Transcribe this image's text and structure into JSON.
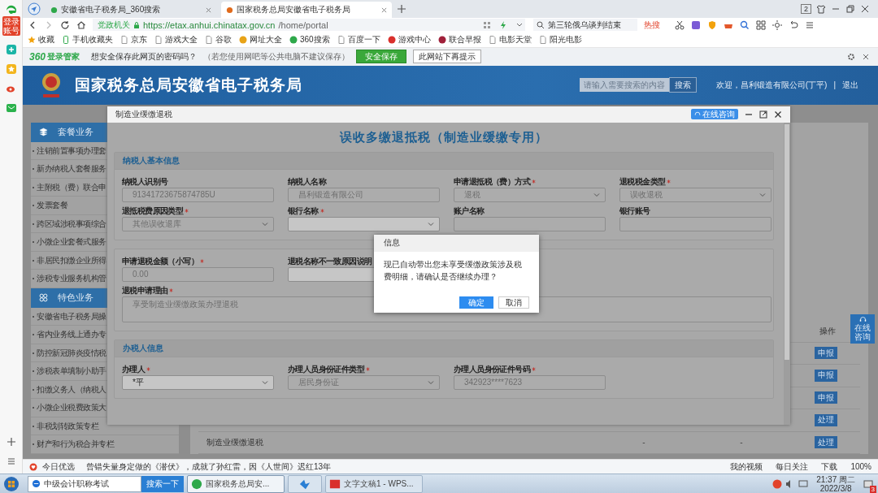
{
  "sidebar_strip": {
    "login_label": "登录账号"
  },
  "tabs": [
    {
      "title": "安徽省电子税务局_360搜索",
      "selected": false
    },
    {
      "title": "国家税务总局安徽省电子税务局",
      "selected": true
    }
  ],
  "window_badge": "2",
  "address_bar": {
    "badge": "党政机关",
    "url_host": "https://etax.anhui.chinatax.gov.cn",
    "url_path": "/home/portal"
  },
  "search_bar": {
    "value": "第三轮俄乌谈判结束",
    "hot": "热搜"
  },
  "bookmarks": [
    {
      "label": "收藏",
      "kind": "star"
    },
    {
      "label": "手机收藏夹",
      "kind": "phone"
    },
    {
      "label": "京东",
      "kind": "page"
    },
    {
      "label": "游戏大全",
      "kind": "page"
    },
    {
      "label": "谷歌",
      "kind": "page"
    },
    {
      "label": "网址大全",
      "kind": "logo",
      "color": "#e8a317"
    },
    {
      "label": "360搜索",
      "kind": "logo",
      "color": "#2ea84a"
    },
    {
      "label": "百度一下",
      "kind": "page"
    },
    {
      "label": "游戏中心",
      "kind": "logo",
      "color": "#d9302c"
    },
    {
      "label": "联合早报",
      "kind": "logo",
      "color": "#a0203a"
    },
    {
      "label": "电影天堂",
      "kind": "page"
    },
    {
      "label": "阳光电影",
      "kind": "page"
    }
  ],
  "password_bar": {
    "brand": "360",
    "brand_sub": "登录管家",
    "question": "想安全保存此网页的密码吗？",
    "hint": "（若您使用网吧等公共电脑不建议保存）",
    "save": "安全保存",
    "never": "此网站下再提示"
  },
  "site_header": {
    "title": "国家税务总局安徽省电子税务局",
    "search_placeholder": "请输入需要搜索的内容",
    "search_button": "搜索",
    "welcome": "欢迎，昌利锻造有限公司(丁平)",
    "separator": "|",
    "logout": "退出"
  },
  "menu": [
    {
      "title": "套餐业务",
      "kind": "package",
      "items": [
        "注销前置事项办理套",
        "新办纳税人套餐服务",
        "主附税（费）联合申",
        "发票套餐",
        "跨区域涉税事项综合",
        "小微企业套餐式服务",
        "非居民扣缴企业所得",
        "涉税专业服务机构管"
      ]
    },
    {
      "title": "特色业务",
      "kind": "feature",
      "items": [
        "安徽省电子税务局操",
        "省内业务线上通办专",
        "防控新冠肺炎疫情税",
        "涉税表单填制小助手",
        "扣缴义务人（纳税人",
        "小微企业税费政策大",
        "非税划转政策专栏",
        "财产和行为税合并专栏"
      ]
    }
  ],
  "table": {
    "action_header": "操作",
    "rows": [
      {
        "action": "申报"
      },
      {
        "action": "申报"
      },
      {
        "action": "申报"
      },
      {
        "action": "处理"
      },
      {
        "name": "制造业缓缴退税",
        "column_2": "-",
        "column_3": "-",
        "action": "处理"
      }
    ]
  },
  "float_button": "在线咨询",
  "modal": {
    "title": "制造业缓缴退税",
    "consult": "在线咨询",
    "heading": "误收多缴退抵税（制造业缓缴专用）",
    "sections": [
      {
        "title": "纳税人基本信息",
        "fields": [
          {
            "label": "纳税人识别号",
            "kind": "input",
            "value": "91341723675874785U",
            "required": false,
            "disabled": true
          },
          {
            "label": "纳税人名称",
            "kind": "input",
            "value": "昌利锻造有限公司",
            "required": false,
            "disabled": true
          },
          {
            "label": "申请退抵税（费）方式",
            "kind": "select",
            "value": "退税",
            "required": true,
            "disabled": true
          },
          {
            "label": "退税税金类型",
            "kind": "select",
            "value": "误收退税",
            "required": true,
            "disabled": true
          },
          {
            "label": "退抵税费原因类型",
            "kind": "select",
            "value": "其他误收退库",
            "required": true,
            "disabled": true
          },
          {
            "label": "银行名称",
            "kind": "select",
            "required": true,
            "disabled": false
          },
          {
            "label": "账户名称",
            "kind": "input",
            "required": false,
            "disabled": true
          },
          {
            "label": "银行账号",
            "kind": "input",
            "required": false,
            "disabled": true
          }
        ]
      },
      {
        "fields": [
          {
            "label": "申请退税金额（小写）",
            "kind": "input",
            "value": "0.00",
            "required": true,
            "disabled": true
          },
          {
            "label": "退税名称不一致原因说明",
            "kind": "input",
            "required": false,
            "disabled": false
          },
          {
            "label": "退税申请理由",
            "kind": "textarea",
            "value": "享受制造业缓缴政策办理退税",
            "required": true,
            "disabled": true
          }
        ]
      },
      {
        "title": "办税人信息",
        "fields": [
          {
            "label": "办理人",
            "kind": "select",
            "value": "*平",
            "required": true,
            "disabled": false
          },
          {
            "label": "办理人员身份证件类型",
            "kind": "select",
            "value": "居民身份证",
            "required": true,
            "disabled": true
          },
          {
            "label": "办理人员身份证件号码",
            "kind": "input",
            "value": "342923****7623",
            "required": true,
            "disabled": true
          }
        ]
      }
    ]
  },
  "dialog": {
    "title": "信息",
    "message": "现已自动带出您未享受缓缴政策涉及税费明细，请确认是否继续办理？",
    "buttons": [
      {
        "label": "确定",
        "kind": "primary"
      },
      {
        "label": "取消",
        "kind": "plain"
      }
    ]
  },
  "status_bar": {
    "today": "今日优选",
    "news": "曾错失量身定做的《潜伏》，成就了孙红雷，因《人世间》迟红13年",
    "items": [
      "我的视频",
      "每日关注",
      "下载",
      "100%"
    ]
  },
  "taskbar": {
    "search_value": "中级会计职称考试",
    "search_button": "搜索一下",
    "tasks": [
      {
        "title": "国家税务总局安...",
        "kind": "browser",
        "selected": true
      },
      {
        "kind": "bird",
        "selected": false
      },
      {
        "title": "文字文稿1 - WPS...",
        "kind": "wps",
        "selected": false
      }
    ],
    "time": "21:37 周二",
    "date": "2022/3/8",
    "notice_count": "3"
  }
}
